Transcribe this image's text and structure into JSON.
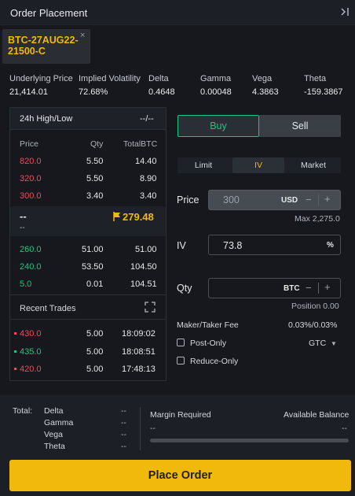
{
  "header": {
    "title": "Order Placement",
    "collapse_icon": "collapse-right-icon"
  },
  "tab": {
    "label": "BTC-27AUG22-21500-C",
    "close": "×"
  },
  "greeks": [
    {
      "label": "Underlying Price",
      "value": "21,414.01"
    },
    {
      "label": "Implied Volatility",
      "value": "72.68%"
    },
    {
      "label": "Delta",
      "value": "0.4648"
    },
    {
      "label": "Gamma",
      "value": "0.00048"
    },
    {
      "label": "Vega",
      "value": "4.3863"
    },
    {
      "label": "Theta",
      "value": "-159.3867"
    }
  ],
  "orderbook": {
    "hl_label": "24h High/Low",
    "hl_value": "--/--",
    "columns": [
      "Price",
      "Qty",
      "TotalBTC"
    ],
    "asks": [
      {
        "price": "820.0",
        "qty": "5.50",
        "total": "14.40"
      },
      {
        "price": "320.0",
        "qty": "5.50",
        "total": "8.90"
      },
      {
        "price": "300.0",
        "qty": "3.40",
        "total": "3.40"
      }
    ],
    "mark": {
      "top": "--",
      "bottom": "--",
      "price": "279.48"
    },
    "bids": [
      {
        "price": "260.0",
        "qty": "51.00",
        "total": "51.00"
      },
      {
        "price": "240.0",
        "qty": "53.50",
        "total": "104.50"
      },
      {
        "price": "5.0",
        "qty": "0.01",
        "total": "104.51"
      }
    ],
    "recent_title": "Recent Trades",
    "trades": [
      {
        "price": "430.0",
        "qty": "5.00",
        "time": "18:09:02",
        "side": "sell"
      },
      {
        "price": "435.0",
        "qty": "5.00",
        "time": "18:08:51",
        "side": "buy"
      },
      {
        "price": "420.0",
        "qty": "5.00",
        "time": "17:48:13",
        "side": "sell"
      }
    ]
  },
  "order": {
    "buy": "Buy",
    "sell": "Sell",
    "types": [
      "Limit",
      "IV",
      "Market"
    ],
    "active_type": "IV",
    "price_label": "Price",
    "price_value": "300",
    "price_unit": "USD",
    "price_max": "Max 2,275.0",
    "iv_label": "IV",
    "iv_value": "73.8",
    "iv_unit": "%",
    "qty_label": "Qty",
    "qty_unit": "BTC",
    "position": "Position 0.00",
    "fee_label": "Maker/Taker Fee",
    "fee_value": "0.03%/0.03%",
    "post_only": "Post-Only",
    "tif": "GTC",
    "reduce_only": "Reduce-Only",
    "minus": "−",
    "plus": "+"
  },
  "footer": {
    "total_label": "Total:",
    "rows": [
      {
        "label": "Delta",
        "value": "--"
      },
      {
        "label": "Gamma",
        "value": "--"
      },
      {
        "label": "Vega",
        "value": "--"
      },
      {
        "label": "Theta",
        "value": "--"
      }
    ],
    "margin_label": "Margin Required",
    "margin_value": "--",
    "balance_label": "Available Balance",
    "balance_value": "--",
    "place_order": "Place Order"
  },
  "colors": {
    "accent": "#f0b90b",
    "buy": "#0ecb81",
    "sell": "#f6465d"
  }
}
